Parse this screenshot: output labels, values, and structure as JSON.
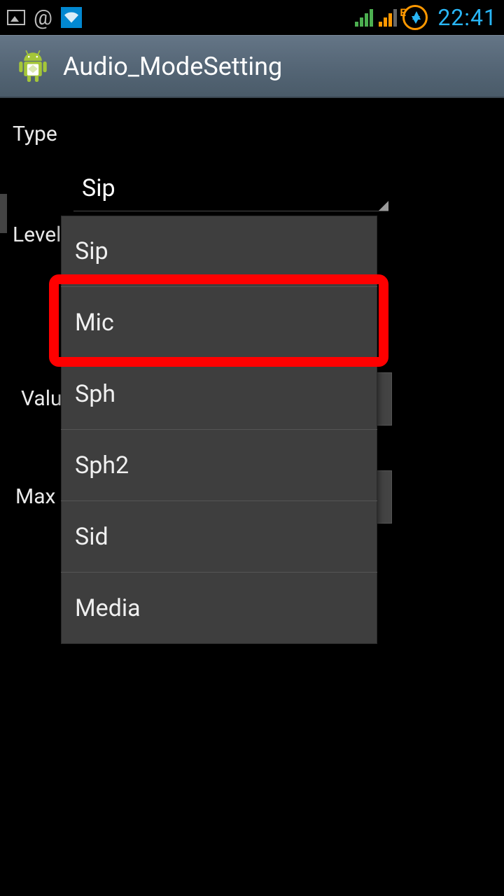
{
  "status_bar": {
    "clock": "22:41"
  },
  "app": {
    "title": "Audio_ModeSetting"
  },
  "labels": {
    "type": "Type",
    "level": "Level",
    "value": "Value",
    "max_vol": "Max V"
  },
  "spinner": {
    "selected": "Sip"
  },
  "dropdown": {
    "options": [
      {
        "label": "Sip"
      },
      {
        "label": "Mic"
      },
      {
        "label": "Sph"
      },
      {
        "label": "Sph2"
      },
      {
        "label": "Sid"
      },
      {
        "label": "Media"
      }
    ],
    "highlighted_index": 1
  }
}
